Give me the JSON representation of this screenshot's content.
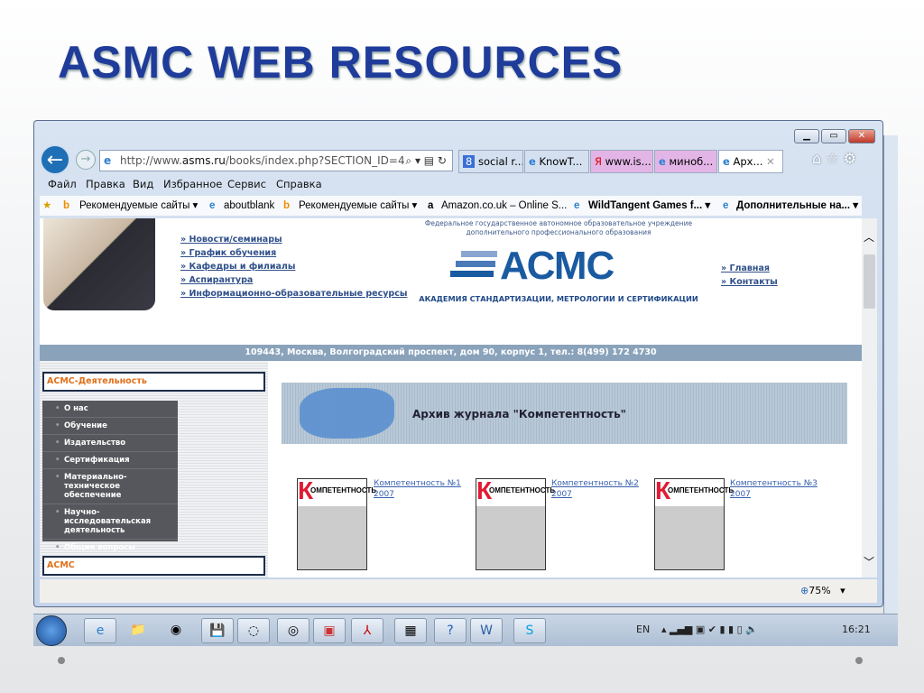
{
  "slide": {
    "title": "ASMC WEB RESOURCES"
  },
  "browser": {
    "address": {
      "prefix": "http://www.",
      "domain": "asms.ru",
      "path": "/books/index.php?SECTION_ID=4"
    },
    "tabs": [
      {
        "label": "social r..."
      },
      {
        "label": "KnowT..."
      },
      {
        "label": "www.is..."
      },
      {
        "label": "миноб..."
      },
      {
        "label": "Арх..."
      }
    ],
    "menu": [
      "Файл",
      "Правка",
      "Вид",
      "Избранное",
      "Сервис",
      "Справка"
    ],
    "favorites": [
      "Рекомендуемые сайты ▾",
      "aboutblank",
      "Рекомендуемые сайты ▾",
      "Amazon.co.uk – Online S...",
      "WildTangent Games f... ▾",
      "Дополнительные на... ▾"
    ],
    "zoom": "75%"
  },
  "site": {
    "nav": [
      "» Новости/семинары",
      "» График обучения",
      "» Кафедры и филиалы",
      "» Аспирантура",
      "» Информационно-образовательные ресурсы"
    ],
    "org_line1": "Федеральное государственное автономное образовательное учреждение",
    "org_line2": "дополнительного профессионального образования",
    "logo": "АСМС",
    "academy": "АКАДЕМИЯ СТАНДАРТИЗАЦИИ, МЕТРОЛОГИИ И СЕРТИФИКАЦИИ",
    "right_nav": [
      "» Главная",
      "» Контакты"
    ],
    "address": "109443, Москва, Волгоградский проспект, дом 90, корпус 1, тел.: 8(499) 172 4730",
    "section1": "АСМС-Деятельность",
    "menu": [
      "О нас",
      "Обучение",
      "Издательство",
      "Сертификация",
      "Материально-техническое обеспечение",
      "Научно-исследовательская деятельность",
      "Общие вопросы"
    ],
    "section2": "АСМС",
    "banner": "Архив журнала \"Компетентность\"",
    "issues": [
      {
        "title": "Компетентность №1",
        "year": "2007"
      },
      {
        "title": "Компетентность №2",
        "year": "2007"
      },
      {
        "title": "Компетентность №3",
        "year": "2007"
      }
    ],
    "cover_k": "К",
    "cover_title": "ОМПЕТЕНТНОСТЬ"
  },
  "taskbar": {
    "lang": "EN",
    "time": "16:21"
  }
}
